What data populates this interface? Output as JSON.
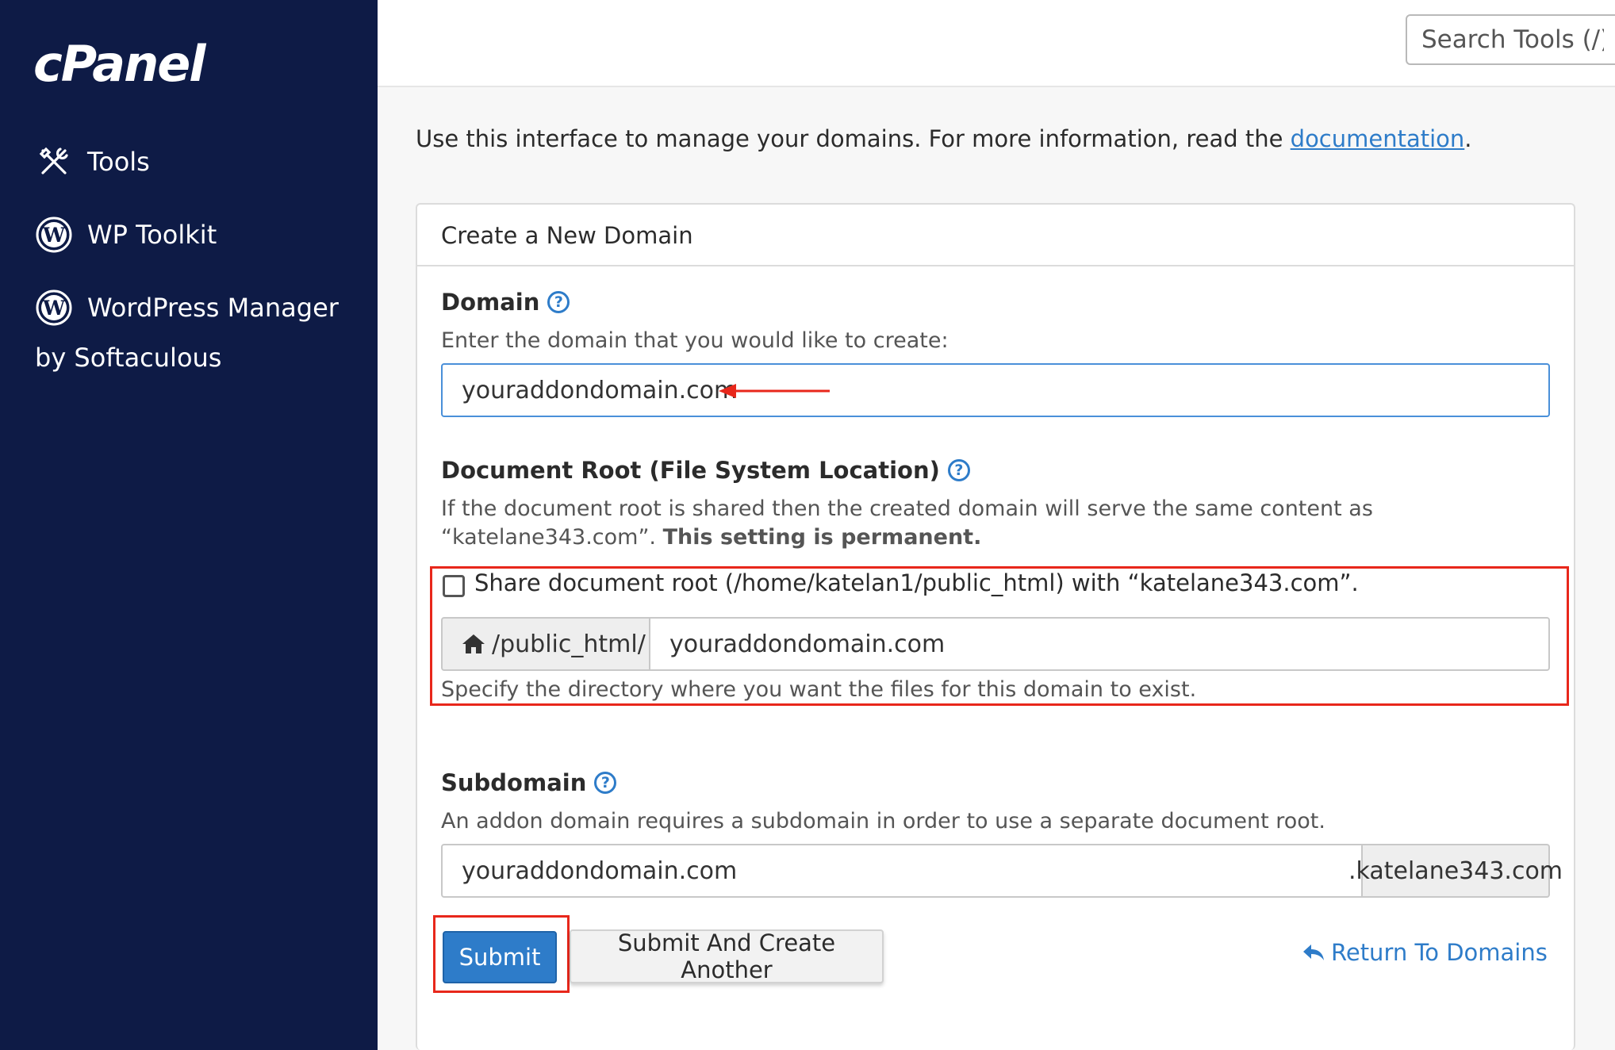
{
  "sidebar": {
    "logo": "cPanel",
    "items": [
      {
        "label": "Tools",
        "icon": "tools-icon"
      },
      {
        "label": "WP Toolkit",
        "icon": "wordpress-icon"
      },
      {
        "label": "WordPress Manager",
        "icon": "wordpress-icon"
      }
    ],
    "sub_label": "by Softaculous"
  },
  "header": {
    "search_placeholder": "Search Tools (/)"
  },
  "intro": {
    "text": "Use this interface to manage your domains. For more information, read the ",
    "link": "documentation",
    "suffix": "."
  },
  "panel": {
    "title": "Create a New Domain",
    "domain": {
      "label": "Domain",
      "hint": "Enter the domain that you would like to create:",
      "value": "youraddondomain.com"
    },
    "docroot": {
      "label": "Document Root (File System Location)",
      "hint_part1": "If the document root is shared then the created domain will serve the same content as “katelane343.com”. ",
      "hint_bold": "This setting is permanent.",
      "checkbox_label": "Share document root (/home/katelan1/public_html) with “katelane343.com”.",
      "prefix": "/public_html/",
      "value": "youraddondomain.com",
      "help_text": "Specify the directory where you want the files for this domain to exist."
    },
    "subdomain": {
      "label": "Subdomain",
      "hint": "An addon domain requires a subdomain in order to use a separate document root.",
      "value": "youraddondomain.com",
      "suffix": ".katelane343.com"
    },
    "buttons": {
      "submit": "Submit",
      "submit_another": "Submit And Create Another",
      "return": "Return To Domains"
    }
  },
  "colors": {
    "sidebar_bg": "#0e1b46",
    "accent": "#2e7cc9",
    "annotation": "#e8271b"
  }
}
